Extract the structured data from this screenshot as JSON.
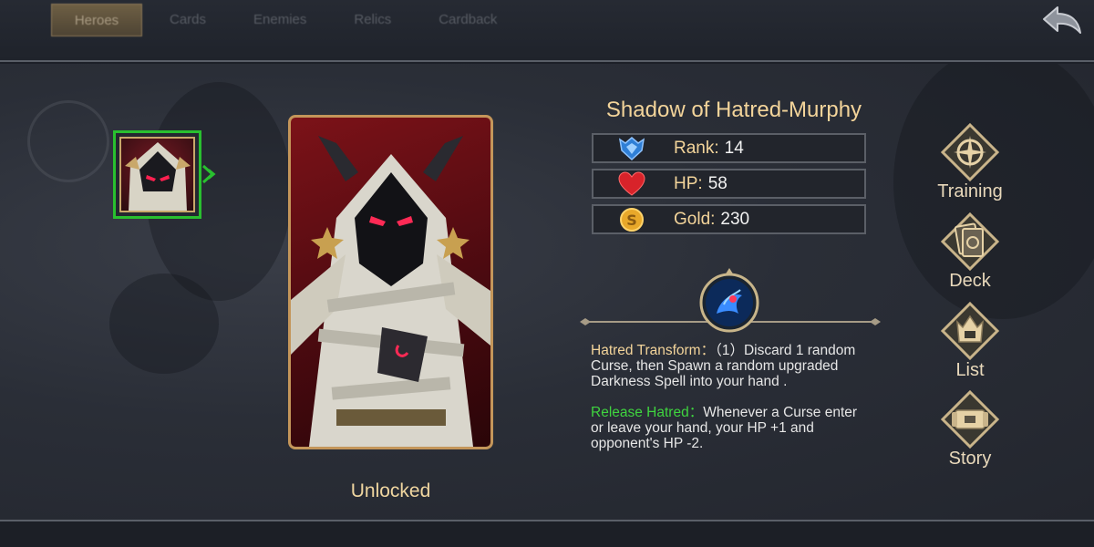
{
  "tabs": [
    {
      "label": "Heroes",
      "active": true
    },
    {
      "label": "Cards",
      "active": false
    },
    {
      "label": "Enemies",
      "active": false
    },
    {
      "label": "Relics",
      "active": false
    },
    {
      "label": "Cardback",
      "active": false
    }
  ],
  "back_icon": "back-arrow-icon",
  "hero": {
    "name": "Shadow of Hatred-Murphy",
    "status": "Unlocked",
    "stats": [
      {
        "icon": "rank-icon",
        "label": "Rank:",
        "value": "14",
        "color": "#2f7fd6"
      },
      {
        "icon": "heart-icon",
        "label": "HP:",
        "value": "58",
        "color": "#d8232a"
      },
      {
        "icon": "gold-coin-icon",
        "label": "Gold:",
        "value": "230",
        "color": "#e8a82a"
      }
    ],
    "skills": [
      {
        "name": "Hatred Transform：",
        "text": "（1）Discard 1 random Curse,  then Spawn a random upgraded Darkness Spell into your hand ."
      },
      {
        "name": "Release Hatred：",
        "text": "Whenever a Curse enter or leave your hand,  your HP +1 and opponent's HP -2."
      }
    ]
  },
  "menu": [
    {
      "label": "Training",
      "icon": "training-compass-icon"
    },
    {
      "label": "Deck",
      "icon": "deck-cards-icon"
    },
    {
      "label": "List",
      "icon": "list-helmet-icon"
    },
    {
      "label": "Story",
      "icon": "story-scroll-icon"
    }
  ],
  "colors": {
    "accent_gold": "#f3d49a",
    "selected_green": "#29c02f",
    "frame_bronze": "#c4965a"
  }
}
